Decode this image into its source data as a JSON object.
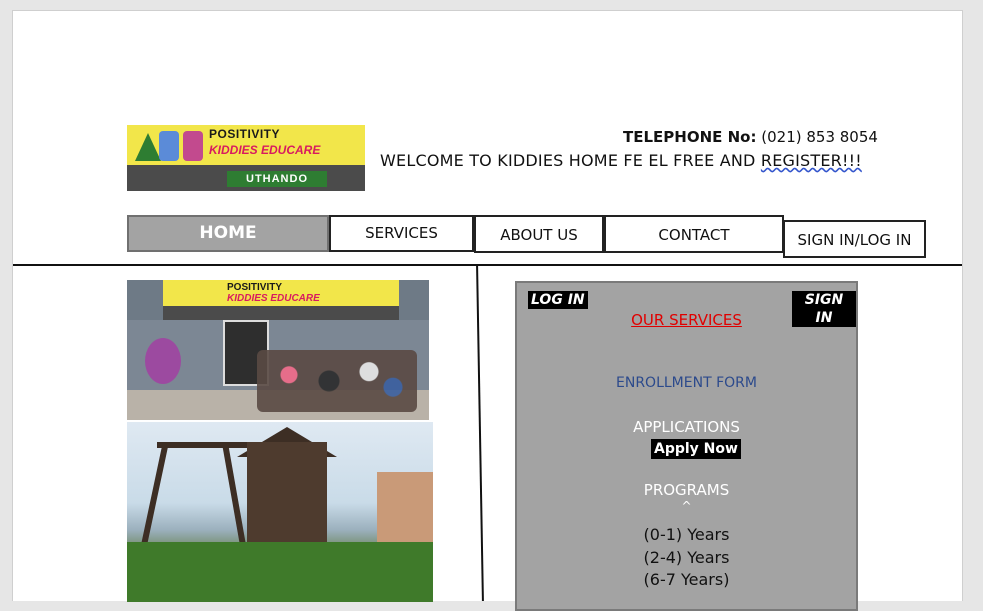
{
  "header": {
    "logo": {
      "line1": "POSITIVITY",
      "line2": "KIDDIES EDUCARE",
      "line3": "UTHANDO"
    },
    "telephone_label": "TELEPHONE No:",
    "telephone_number": "(021) 853 8054",
    "welcome_main": "WELCOME TO KIDDIES HOME FE EL FREE AND ",
    "welcome_tail": "REGISTER!!!"
  },
  "nav": {
    "home": "HOME",
    "services": "SERVICES",
    "about": "ABOUT US",
    "contact": "CONTACT",
    "signin": "SIGN IN/LOG IN"
  },
  "photos": {
    "photo1_sign_line1": "POSITIVITY",
    "photo1_sign_line2": "KIDDIES EDUCARE"
  },
  "panel": {
    "login_tag": "LOG IN",
    "signin_tag": "SIGN IN",
    "our_services": "OUR SERVICES",
    "enrollment": "ENROLLMENT FORM",
    "applications": "APPLICATIONS",
    "apply_now": "Apply Now",
    "programs": "PROGRAMS",
    "caret": "^",
    "ages": [
      "(0-1) Years",
      "(2-4) Years",
      "(6-7 Years)"
    ]
  },
  "colors": {
    "nav_home_bg": "#a3a3a3",
    "panel_bg": "#a3a3a3",
    "our_services": "#e00000",
    "enrollment": "#2c4a8c",
    "logo_yellow": "#f2e64a"
  }
}
